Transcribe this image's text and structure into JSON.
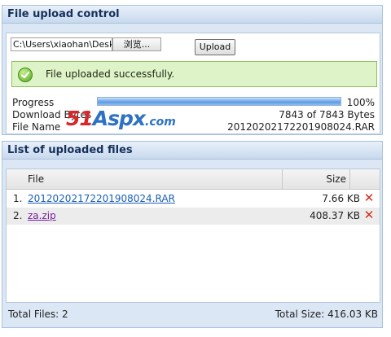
{
  "upload_panel": {
    "title": "File upload control",
    "file_path": "C:\\Users\\xiaohan\\Desktop",
    "browse_label": "浏览...",
    "upload_label": "Upload",
    "success_message": "File uploaded successfully.",
    "progress_label": "Progress",
    "progress_value": "100%",
    "progress_fraction": 1.0,
    "download_label": "Download Bytes",
    "download_value": "7843 of 7843 Bytes",
    "filename_label": "File Name",
    "filename_value": "20120202172201908024.RAR",
    "watermark": {
      "num": "51",
      "aspx": "Aspx",
      "com": ".com"
    }
  },
  "files_panel": {
    "title": "List of uploaded files",
    "col_file": "File",
    "col_size": "Size",
    "rows": [
      {
        "num": "1.",
        "name": "20120202172201908024.RAR",
        "size": "7.66 KB"
      },
      {
        "num": "2.",
        "name": "za.zip",
        "size": "408.37 KB"
      }
    ],
    "total_files": "Total Files: 2",
    "total_size": "Total Size: 416.03 KB"
  },
  "colors": {
    "accent": "#15305a",
    "success_bg": "#dff3c9",
    "delete": "#d12a1d"
  },
  "icons": {
    "success": "check-circle-icon",
    "delete": "close-x-icon"
  }
}
